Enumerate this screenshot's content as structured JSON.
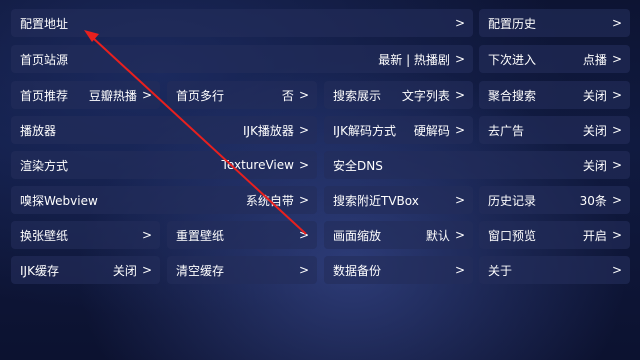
{
  "settings": {
    "config_url": {
      "label": "配置地址",
      "value": "",
      "chevron": ">"
    },
    "config_history": {
      "label": "配置历史",
      "value": "",
      "chevron": ">"
    },
    "home_source": {
      "label": "首页站源",
      "value": "最新 | 热播剧",
      "chevron": ">"
    },
    "next_entry": {
      "label": "下次进入",
      "value": "点播",
      "chevron": ">"
    },
    "home_recommend": {
      "label": "首页推荐",
      "value": "豆瓣热播",
      "chevron": ">"
    },
    "home_multiline": {
      "label": "首页多行",
      "value": "否",
      "chevron": ">"
    },
    "search_display": {
      "label": "搜索展示",
      "value": "文字列表",
      "chevron": ">"
    },
    "aggregate_search": {
      "label": "聚合搜索",
      "value": "关闭",
      "chevron": ">"
    },
    "player": {
      "label": "播放器",
      "value": "IJK播放器",
      "chevron": ">"
    },
    "ijk_decode": {
      "label": "IJK解码方式",
      "value": "硬解码",
      "chevron": ">"
    },
    "remove_ads": {
      "label": "去广告",
      "value": "关闭",
      "chevron": ">"
    },
    "render_mode": {
      "label": "渲染方式",
      "value": "TextureView",
      "chevron": ">"
    },
    "safe_dns": {
      "label": "安全DNS",
      "value": "关闭",
      "chevron": ">"
    },
    "sniff_webview": {
      "label": "嗅探Webview",
      "value": "系统自带",
      "chevron": ">"
    },
    "search_nearby_tvbox": {
      "label": "搜索附近TVBox",
      "value": "",
      "chevron": ">"
    },
    "history_records": {
      "label": "历史记录",
      "value": "30条",
      "chevron": ">"
    },
    "change_wallpaper": {
      "label": "换张壁纸",
      "value": "",
      "chevron": ">"
    },
    "reset_wallpaper": {
      "label": "重置壁纸",
      "value": "",
      "chevron": ">"
    },
    "screen_scale": {
      "label": "画面缩放",
      "value": "默认",
      "chevron": ">"
    },
    "window_preview": {
      "label": "窗口预览",
      "value": "开启",
      "chevron": ">"
    },
    "ijk_cache": {
      "label": "IJK缓存",
      "value": "关闭",
      "chevron": ">"
    },
    "clear_cache": {
      "label": "清空缓存",
      "value": "",
      "chevron": ">"
    },
    "data_backup": {
      "label": "数据备份",
      "value": "",
      "chevron": ">"
    },
    "about": {
      "label": "关于",
      "value": "",
      "chevron": ">"
    }
  },
  "colors": {
    "cell_bg": "#232d5a",
    "text": "#ffffff",
    "annotation_arrow": "#e8201e"
  }
}
